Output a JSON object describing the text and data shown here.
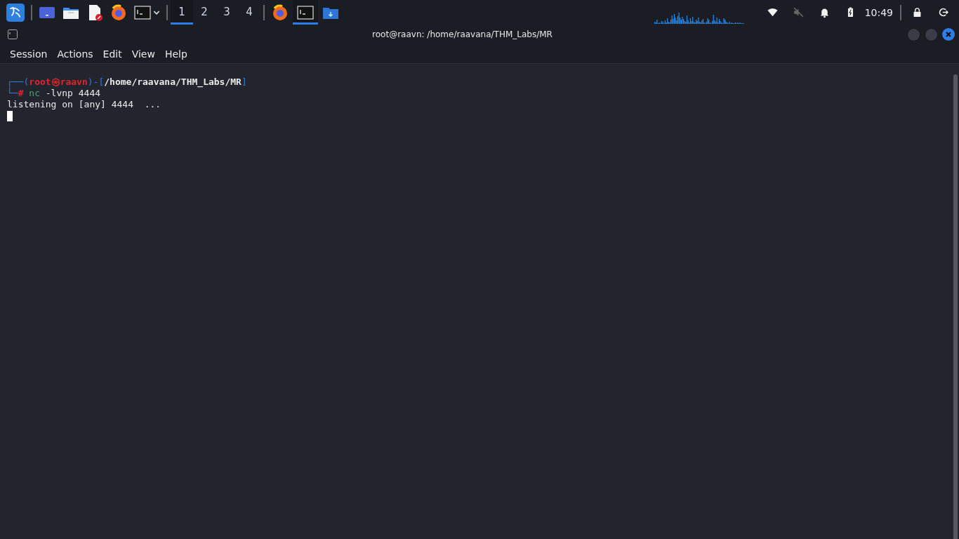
{
  "taskbar": {
    "launchers": [
      {
        "kind": "desktop"
      },
      {
        "kind": "files"
      },
      {
        "kind": "editor"
      },
      {
        "kind": "browser"
      },
      {
        "kind": "terminal"
      }
    ],
    "workspaces": [
      {
        "label": "1",
        "selected": true
      },
      {
        "label": "2",
        "selected": false
      },
      {
        "label": "3",
        "selected": false
      },
      {
        "label": "4",
        "selected": false
      }
    ],
    "tasks": [
      {
        "kind": "browser",
        "selected": false
      },
      {
        "kind": "terminal",
        "selected": true
      },
      {
        "kind": "folder",
        "selected": false
      }
    ],
    "tray": {
      "volume_muted": true,
      "clock": "10:49"
    }
  },
  "window": {
    "title": "root@raavn: /home/raavana/THM_Labs/MR"
  },
  "menu": [
    "Session",
    "Actions",
    "Edit",
    "View",
    "Help"
  ],
  "terminal": {
    "prompt": {
      "top_left": "┌──(",
      "user": "root",
      "at": "㉿",
      "host": "raavn",
      "mid": ")-[",
      "path": "/home/raavana/THM_Labs/MR",
      "close": "]",
      "bottom_left": "└─",
      "sigil": "#"
    },
    "command": "nc",
    "args": "-lvnp 4444",
    "output": [
      "listening on [any] 4444  ..."
    ]
  }
}
